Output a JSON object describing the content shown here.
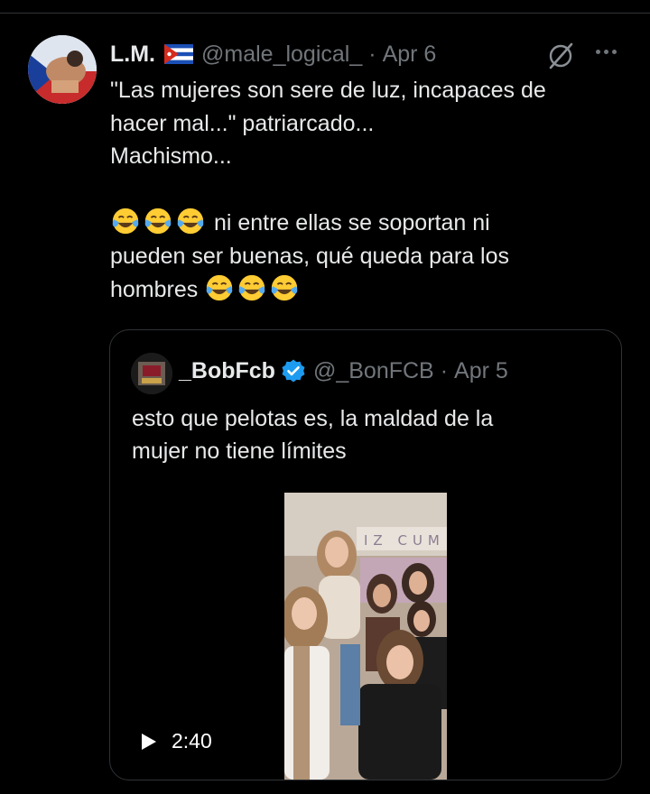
{
  "tweet": {
    "author_name": "L.M.",
    "flag_icon": "cuba-flag-icon",
    "handle": "@male_logical_",
    "separator": "·",
    "date": "Apr 6",
    "text_line1": "\"Las mujeres son sere de luz, incapaces de",
    "text_line2": "hacer mal...\" patriarcado...",
    "text_line3": "Machismo...",
    "text_line5": "ni entre ellas se soportan ni",
    "text_line6": "pueden ser buenas, qué queda para los",
    "text_line7": "hombres",
    "emoji": "face-with-tears-of-joy-icon"
  },
  "quoted": {
    "author_name": "_BobFcb",
    "verified": true,
    "handle": "@_BonFCB",
    "separator": "·",
    "date": "Apr 5",
    "text_line1": "esto que pelotas es, la maldad de la",
    "text_line2": "mujer no tiene límites",
    "video_duration": "2:40",
    "video_banner_text": "IZ CUM"
  },
  "colors": {
    "background": "#000000",
    "text": "#e7e9ea",
    "muted": "#71767b",
    "verified": "#1d9bf0",
    "border": "#2f3336"
  }
}
